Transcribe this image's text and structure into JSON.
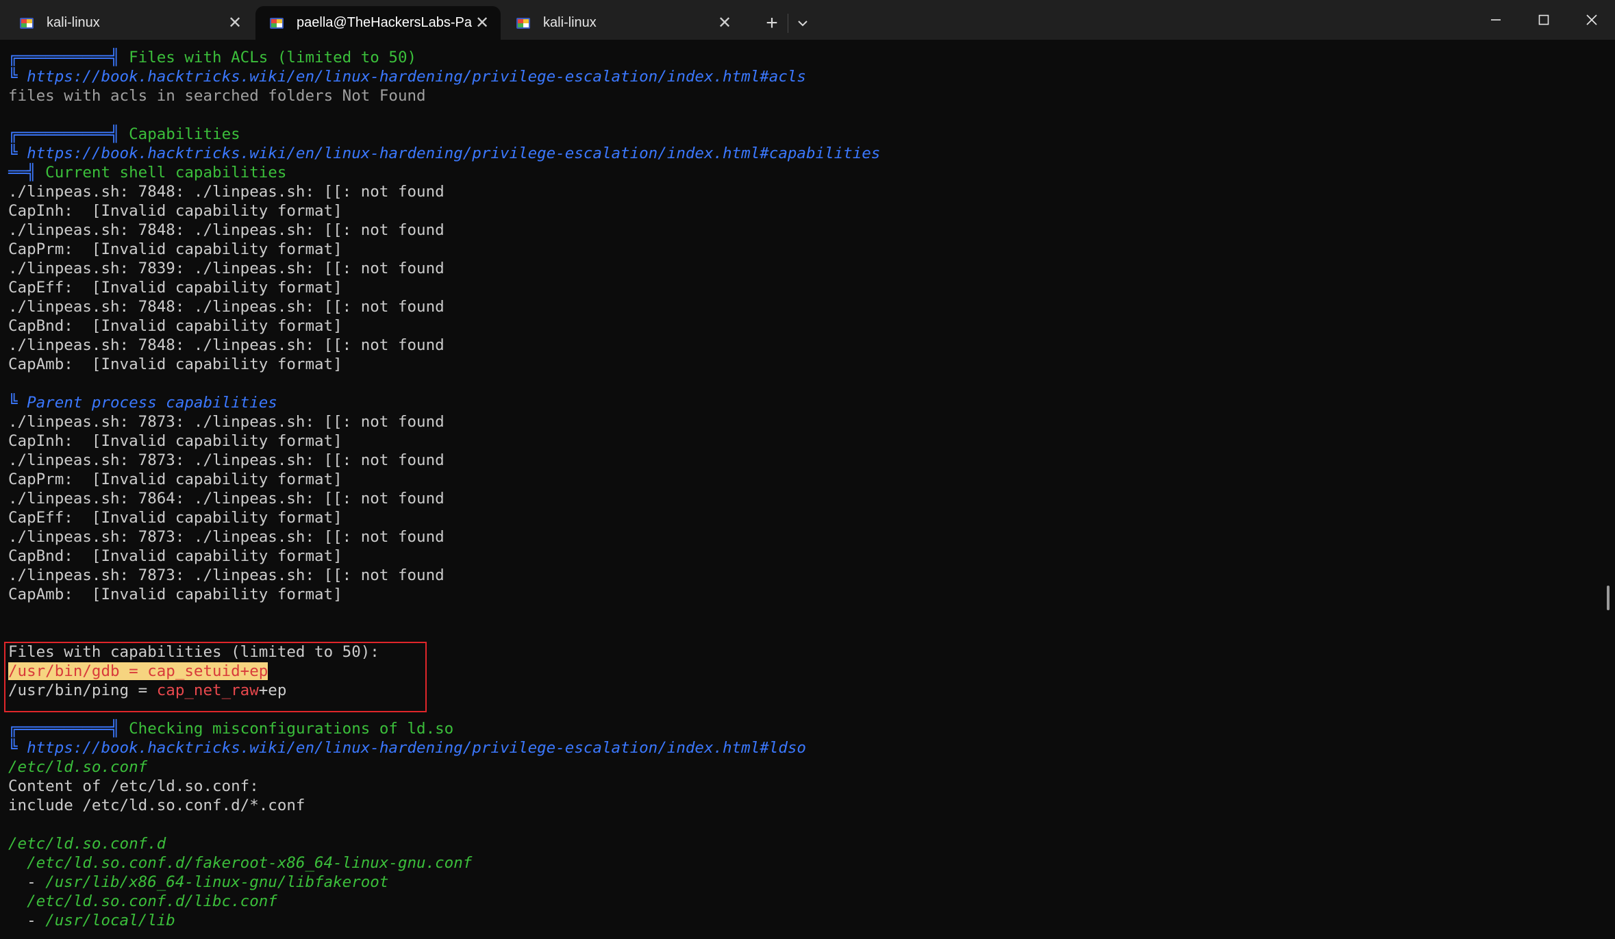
{
  "tabs": [
    {
      "label": "kali-linux",
      "active": false
    },
    {
      "label": "paella@TheHackersLabs-Paella",
      "active": true
    },
    {
      "label": "kali-linux",
      "active": false
    }
  ],
  "window_controls": {
    "new_tab": "+",
    "dropdown": "⌄",
    "minimize": "─",
    "maximize": "☐",
    "close": "✕"
  },
  "colors": {
    "green": "#3bbf3b",
    "link": "#3b78ff",
    "highlight_bg": "#f6d480",
    "box": "#e0262a"
  },
  "terminal": {
    "acls": {
      "header_box": "╔══════════╣",
      "title": " Files with ACLs (limited to 50)",
      "link_prefix": "╚ ",
      "link": "https://book.hacktricks.wiki/en/linux-hardening/privilege-escalation/index.html#acls",
      "result": "files with acls in searched folders Not Found"
    },
    "caps": {
      "header_box": "╔══════════╣",
      "title": " Capabilities",
      "link_prefix": "╚ ",
      "link": "https://book.hacktricks.wiki/en/linux-hardening/privilege-escalation/index.html#capabilities",
      "current_box": "══╣",
      "current_title": " Current shell capabilities",
      "current_lines": [
        "./linpeas.sh: 7848: ./linpeas.sh: [[: not found",
        "CapInh:  [Invalid capability format]",
        "./linpeas.sh: 7848: ./linpeas.sh: [[: not found",
        "CapPrm:  [Invalid capability format]",
        "./linpeas.sh: 7839: ./linpeas.sh: [[: not found",
        "CapEff:  [Invalid capability format]",
        "./linpeas.sh: 7848: ./linpeas.sh: [[: not found",
        "CapBnd:  [Invalid capability format]",
        "./linpeas.sh: 7848: ./linpeas.sh: [[: not found",
        "CapAmb:  [Invalid capability format]"
      ],
      "parent_prefix": "╚ ",
      "parent_title": "Parent process capabilities",
      "parent_lines": [
        "./linpeas.sh: 7873: ./linpeas.sh: [[: not found",
        "CapInh:  [Invalid capability format]",
        "./linpeas.sh: 7873: ./linpeas.sh: [[: not found",
        "CapPrm:  [Invalid capability format]",
        "./linpeas.sh: 7864: ./linpeas.sh: [[: not found",
        "CapEff:  [Invalid capability format]",
        "./linpeas.sh: 7873: ./linpeas.sh: [[: not found",
        "CapBnd:  [Invalid capability format]",
        "./linpeas.sh: 7873: ./linpeas.sh: [[: not found",
        "CapAmb:  [Invalid capability format]"
      ],
      "files_title": "Files with capabilities (limited to 50):",
      "gdb_line": "/usr/bin/gdb = cap_setuid+ep",
      "ping_prefix": "/usr/bin/ping = ",
      "ping_cap": "cap_net_raw",
      "ping_suffix": "+ep"
    },
    "ldso": {
      "header_box": "╔══════════╣",
      "title": " Checking misconfigurations of ld.so",
      "link_prefix": "╚ ",
      "link": "https://book.hacktricks.wiki/en/linux-hardening/privilege-escalation/index.html#ldso",
      "conf_path": "/etc/ld.so.conf",
      "content_of": "Content of /etc/ld.so.conf:",
      "include_line": "include /etc/ld.so.conf.d/*.conf",
      "confd_path": "/etc/ld.so.conf.d",
      "fakeroot_conf": "  /etc/ld.so.conf.d/fakeroot-x86_64-linux-gnu.conf",
      "fakeroot_dash": "  - ",
      "fakeroot_lib": "/usr/lib/x86_64-linux-gnu/libfakeroot",
      "libc_conf": "  /etc/ld.so.conf.d/libc.conf",
      "libc_dash": "  - ",
      "libc_lib": "/usr/local/lib"
    }
  }
}
